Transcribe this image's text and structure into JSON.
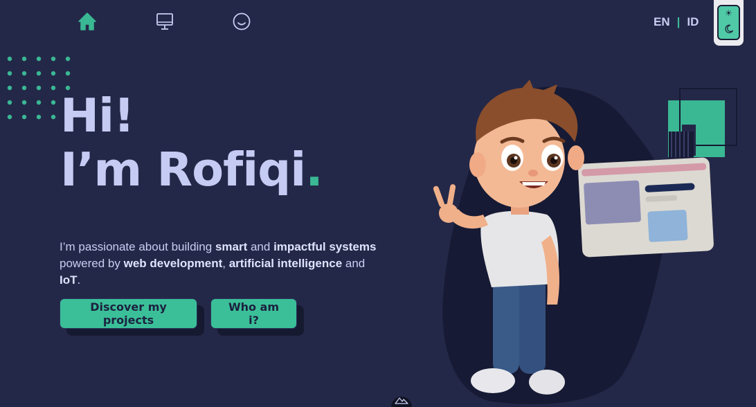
{
  "nav": {
    "icons": [
      "home-icon",
      "monitor-icon",
      "smiley-icon"
    ],
    "active": "home"
  },
  "lang": {
    "en": "EN",
    "separator": "|",
    "id": "ID"
  },
  "theme": {
    "icons": [
      "sun-icon",
      "moon-icon"
    ]
  },
  "hero": {
    "line1": "Hi!",
    "line2": "I’m Rofiqi",
    "dot": ".",
    "desc": {
      "p1": "I’m passionate about building ",
      "b1": "smart",
      "p2": " and ",
      "b2": "impactful systems",
      "p3": " powered by ",
      "b3": "web development",
      "p4": ", ",
      "b4": "artificial intelligence",
      "p5": " and ",
      "b5": "IoT",
      "p6": "."
    }
  },
  "buttons": {
    "projects": "Discover my projects",
    "about": "Who am i?"
  },
  "colors": {
    "background": "#242848",
    "accent": "#3ab894",
    "heading": "#c6cbf4",
    "button": "#3bbf98"
  }
}
